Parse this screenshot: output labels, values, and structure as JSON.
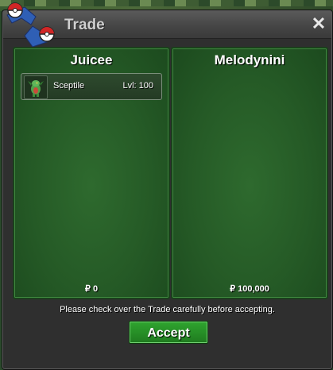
{
  "window": {
    "title": "Trade",
    "close_label": "✕"
  },
  "trade": {
    "left": {
      "player_name": "Juicee",
      "items": [
        {
          "name": "Sceptile",
          "level": "Lvl: 100"
        }
      ],
      "money": "₽ 0"
    },
    "right": {
      "player_name": "Melodynini",
      "items": [],
      "money": "₽ 100,000"
    }
  },
  "notice": "Please check over the Trade carefully before accepting.",
  "accept_label": "Accept",
  "colors": {
    "panel_green": "#255a26",
    "accept_green": "#2fa52f"
  },
  "icons": {
    "logo": "pokeball-swap-icon",
    "item": "sceptile-sprite-icon"
  }
}
